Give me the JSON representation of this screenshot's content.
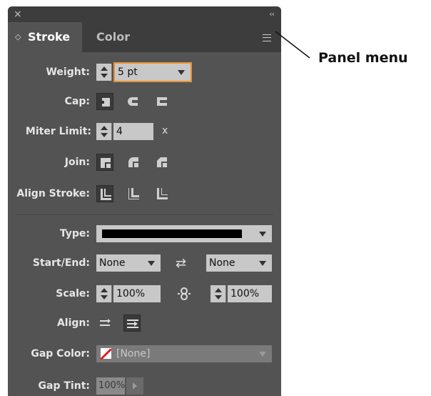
{
  "panel": {
    "close_glyph": "×",
    "collapse_glyph": "‹‹",
    "tabs": [
      {
        "label": "Stroke",
        "active": true,
        "updown_glyph": "◇"
      },
      {
        "label": "Color",
        "active": false
      }
    ]
  },
  "stroke": {
    "weight": {
      "label": "Weight:",
      "value": "5 pt"
    },
    "cap": {
      "label": "Cap:"
    },
    "miter_limit": {
      "label": "Miter Limit:",
      "value": "4",
      "suffix": "x"
    },
    "join": {
      "label": "Join:"
    },
    "align_stroke": {
      "label": "Align Stroke:"
    },
    "type": {
      "label": "Type:"
    },
    "start_end": {
      "label": "Start/End:",
      "start": "None",
      "end": "None"
    },
    "scale": {
      "label": "Scale:",
      "start": "100%",
      "end": "100%"
    },
    "align": {
      "label": "Align:"
    },
    "gap_color": {
      "label": "Gap Color:",
      "value": "[None]"
    },
    "gap_tint": {
      "label": "Gap Tint:",
      "value": "100%"
    }
  },
  "callout": {
    "label": "Panel menu"
  },
  "colors": {
    "panel_bg": "#535353",
    "titlebar_bg": "#3d3d3d",
    "focus_orange": "#e8912d",
    "field_bg": "#c8c8c8",
    "none_red": "#e02020"
  }
}
